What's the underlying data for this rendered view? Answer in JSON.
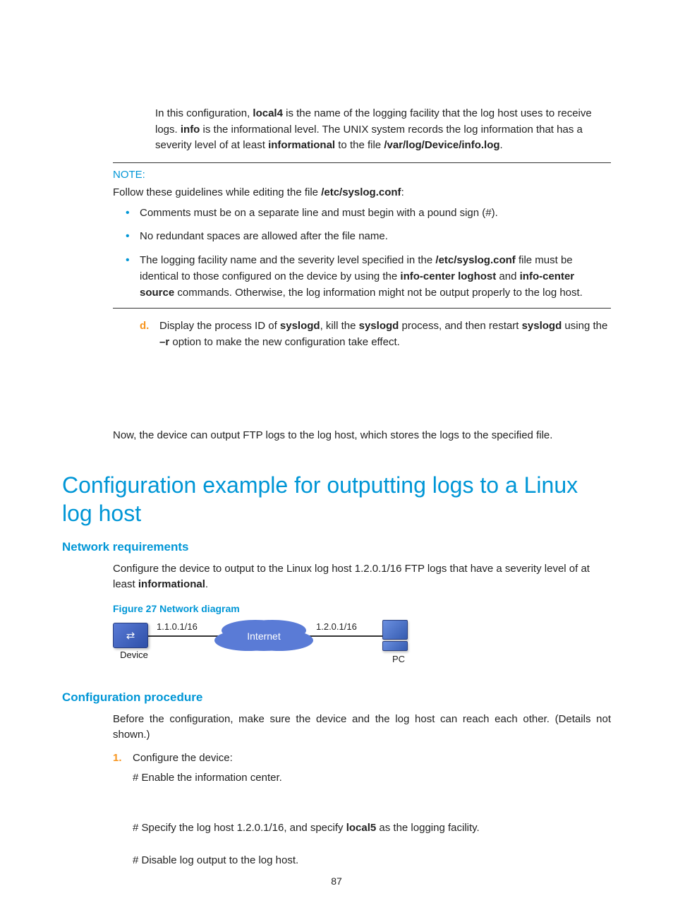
{
  "intro": {
    "pre": "In this configuration, ",
    "bold1": "local4",
    "mid1": " is the name of the logging facility that the log host uses to receive logs. ",
    "bold2": "info",
    "mid2": " is the informational level. The UNIX system records the log information that has a severity level of at least ",
    "bold3": "informational",
    "mid3": " to the file ",
    "bold4": "/var/log/Device/info.log",
    "end": "."
  },
  "note": {
    "label": "NOTE:",
    "lead_pre": "Follow these guidelines while editing the file ",
    "lead_bold": "/etc/syslog.conf",
    "lead_end": ":",
    "b1": "Comments must be on a separate line and must begin with a pound sign (#).",
    "b2": "No redundant spaces are allowed after the file name.",
    "b3_pre": "The logging facility name and the severity level specified in the ",
    "b3_bold1": "/etc/syslog.conf",
    "b3_mid1": " file must be identical to those configured on the device by using the ",
    "b3_bold2": "info-center loghost",
    "b3_mid2": " and ",
    "b3_bold3": "info-center source",
    "b3_end": " commands. Otherwise, the log information might not be output properly to the log host."
  },
  "step_d": {
    "marker": "d.",
    "pre": "Display the process ID of ",
    "bold1": "syslogd",
    "mid1": ", kill the ",
    "bold2": "syslogd",
    "mid2": " process, and then restart ",
    "bold3": "syslogd",
    "mid3": " using the ",
    "bold4": "–r",
    "end": " option to make the new configuration take effect."
  },
  "closing": "Now, the device can output FTP logs to the log host, which stores the logs to the specified file.",
  "h1": "Configuration example for outputting logs to a Linux log host",
  "netreq": {
    "heading": "Network requirements",
    "pre": "Configure the device to output to the Linux log host 1.2.0.1/16 FTP logs that have a severity level of at least ",
    "bold": "informational",
    "end": "."
  },
  "figcap": "Figure 27 Network diagram",
  "diagram": {
    "device": "Device",
    "ip1": "1.1.0.1/16",
    "internet": "Internet",
    "ip2": "1.2.0.1/16",
    "pc": "PC"
  },
  "confproc": {
    "heading": "Configuration procedure",
    "lead": "Before the configuration, make sure the device and the log host can reach each other. (Details not shown.)",
    "step1_num": "1.",
    "step1_text": "Configure the device:",
    "sub1": "# Enable the information center.",
    "sub2_pre": "# Specify the log host 1.2.0.1/16, and specify ",
    "sub2_bold": "local5",
    "sub2_end": " as the logging facility.",
    "sub3": "# Disable log output to the log host."
  },
  "pagenum": "87"
}
